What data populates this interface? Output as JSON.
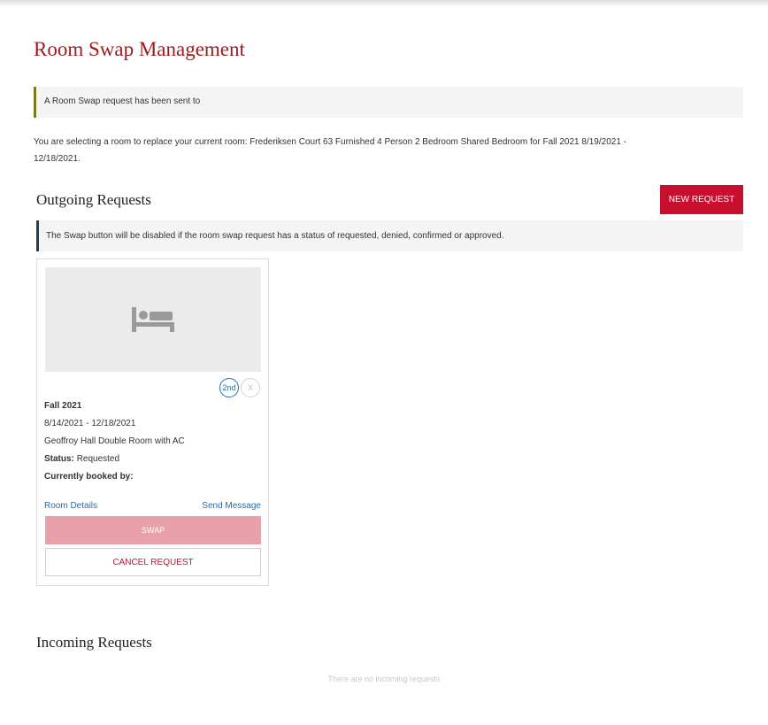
{
  "page": {
    "title": "Room Swap Management"
  },
  "alerts": {
    "request_sent": "A Room Swap request has been sent to",
    "swap_disabled": "The Swap button will be disabled if the room swap request has a status of requested, denied, confirmed or approved."
  },
  "info": {
    "line1": "You are selecting a room to replace your current room: Frederiksen Court 63 Furnished 4 Person 2 Bedroom Shared Bedroom for Fall 2021 8/19/2021 -",
    "line2": "12/18/2021."
  },
  "outgoing": {
    "title": "Outgoing Requests",
    "new_request_label": "NEW REQUEST",
    "cards": [
      {
        "image_icon": "bed-icon",
        "preference": "2nd",
        "preference_remove": "X",
        "term": "Fall 2021",
        "dates": "8/14/2021 - 12/18/2021",
        "room": "Geoffroy Hall Double Room with AC",
        "status_label": "Status:",
        "status_value": "Requested",
        "booked_label": "Currently booked by:",
        "room_details_label": "Room Details",
        "send_message_label": "Send Message",
        "swap_label": "SWAP",
        "cancel_label": "CANCEL REQUEST"
      }
    ]
  },
  "incoming": {
    "title": "Incoming Requests",
    "empty_text": "There are no incoming requests"
  },
  "colors": {
    "accent": "#c8102e",
    "title": "#9b1b1f",
    "link": "#1a6fb5",
    "swap_disabled": "#e8a0a9"
  }
}
